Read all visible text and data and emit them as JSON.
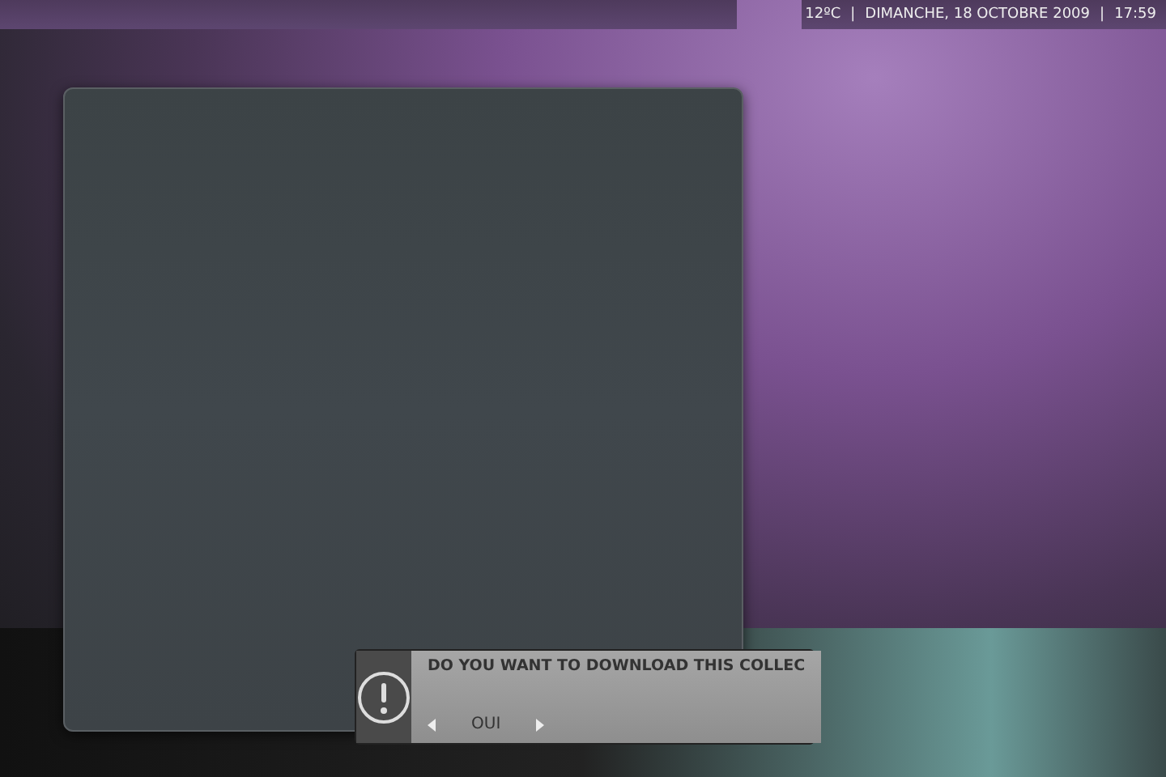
{
  "status_bar": {
    "temperature": "12ºC",
    "separator_1": "|",
    "date": "DIMANCHE, 18 OCTOBRE 2009",
    "separator_2": "|",
    "time": "17:59"
  },
  "dialog": {
    "message": "DO YOU WANT TO DOWNLOAD THIS COLLEC",
    "choice": "OUI"
  }
}
